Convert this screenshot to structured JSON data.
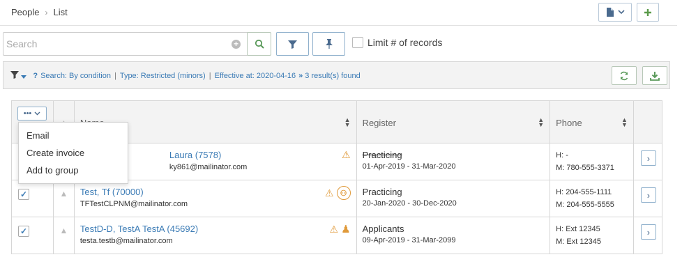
{
  "breadcrumb": {
    "root": "People",
    "separator": "›",
    "current": "List"
  },
  "toolbar": {
    "document_icon": "document-icon",
    "add_icon": "plus-icon"
  },
  "search": {
    "placeholder": "Search",
    "value": ""
  },
  "filter_bar": {
    "limit_label": "Limit # of records",
    "limit_checked": false
  },
  "info": {
    "search_text": "Search: By condition",
    "type_text": "Type: Restricted (minors)",
    "effective_text": "Effective at: 2020-04-16",
    "results_text": "3 result(s) found",
    "separator": "|",
    "chevrons": "»"
  },
  "table": {
    "headers": {
      "name": "Name",
      "register": "Register",
      "phone": "Phone"
    },
    "rows": [
      {
        "checked": true,
        "name": "Laura (7578)",
        "email": "ky861@mailinator.com",
        "status": "Practicing",
        "status_struck": true,
        "dates": "01-Apr-2019 - 31-Mar-2020",
        "phone_home": "H: -",
        "phone_mobile": "M: 780-555-3371"
      },
      {
        "checked": true,
        "name": "Test, Tf (70000)",
        "email": "TFTestCLPNM@mailinator.com",
        "status": "Practicing",
        "status_struck": false,
        "dates": "20-Jan-2020 - 30-Dec-2020",
        "phone_home": "H: 204-555-1111",
        "phone_mobile": "M: 204-555-5555"
      },
      {
        "checked": true,
        "name": "TestD-D, TestA TestA (45692)",
        "email": "testa.testb@mailinator.com",
        "status": "Applicants",
        "status_struck": false,
        "dates": "09-Apr-2019 - 31-Mar-2099",
        "phone_home": "H: Ext 12345",
        "phone_mobile": "M: Ext 12345"
      }
    ]
  },
  "dropdown": {
    "items": [
      "Email",
      "Create invoice",
      "Add to group"
    ]
  },
  "colors": {
    "link": "#3b7bb5",
    "warning": "#e09a3a",
    "success": "#5a9a5a"
  }
}
